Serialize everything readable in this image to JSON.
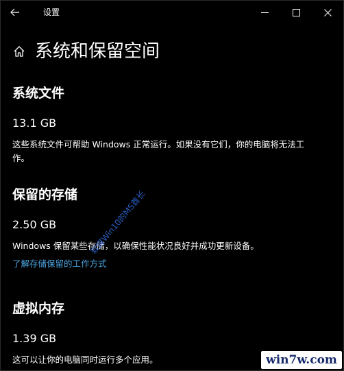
{
  "window": {
    "title": "设置"
  },
  "header": {
    "title": "系统和保留空间"
  },
  "sections": {
    "system_files": {
      "title": "系统文件",
      "size": "13.1 GB",
      "description": "这些系统文件可帮助 Windows 正常运行。如果没有它们，你的电脑将无法工作。"
    },
    "reserved_storage": {
      "title": "保留的存储",
      "size": "2.50 GB",
      "description": "Windows 保留某些存储，以确保性能状况良好并成功更新设备。",
      "link": "了解存储保留的工作方式"
    },
    "virtual_memory": {
      "title": "虚拟内存",
      "size": "1.39 GB",
      "description": "这可以让你的电脑同时运行多个应用。"
    }
  },
  "watermark": {
    "diagonal_text": "软媒Win10的MS酋长",
    "logo_text": "win7w.com"
  },
  "icons": {
    "back": "back-arrow-icon",
    "home": "home-icon",
    "minimize": "minimize-icon",
    "maximize": "maximize-icon",
    "close": "close-icon"
  },
  "colors": {
    "background": "#000000",
    "text": "#ffffff",
    "link": "#4aa3df",
    "watermark": "#2f66d4"
  }
}
